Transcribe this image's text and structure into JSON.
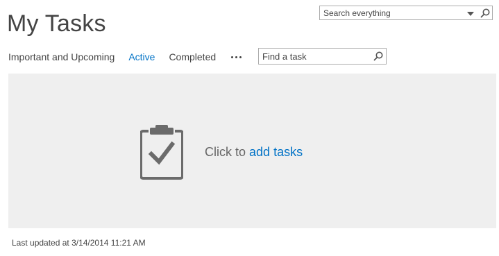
{
  "global_search": {
    "placeholder": "Search everything"
  },
  "page_title": "My Tasks",
  "tabs": [
    {
      "label": "Important and Upcoming",
      "active": false
    },
    {
      "label": "Active",
      "active": true
    },
    {
      "label": "Completed",
      "active": false
    }
  ],
  "find_task": {
    "placeholder": "Find a task"
  },
  "empty_state": {
    "prefix": "Click to",
    "link": "add tasks",
    "icon": "clipboard-check-icon"
  },
  "footer": {
    "last_updated": "Last updated at 3/14/2014 11:21 AM"
  },
  "colors": {
    "accent": "#0072c6",
    "panel_bg": "#efefef",
    "text": "#444444"
  }
}
